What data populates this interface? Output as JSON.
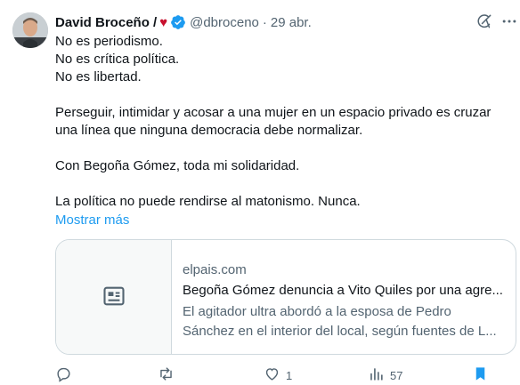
{
  "author": {
    "name": "David Broceño /",
    "emoji": "♥",
    "handle": "@dbroceno",
    "separator": "·",
    "date": "29 abr."
  },
  "tweet": {
    "lines": [
      "No es periodismo.",
      "No es crítica política.",
      "No es libertad.",
      "Perseguir, intimidar y acosar a una mujer en un espacio privado es cruzar",
      "una línea que ninguna democracia debe normalizar.",
      "Con Begoña Gómez, toda mi solidaridad.",
      "La política no puede rendirse al matonismo. Nunca."
    ],
    "show_more": "Mostrar más"
  },
  "card": {
    "domain": "elpais.com",
    "title": "Begoña Gómez denuncia a Vito Quiles por una agre...",
    "description_line1": "El agitador ultra abordó a la esposa de Pedro",
    "description_line2": "Sánchez en el interior del local, según fuentes de L..."
  },
  "actions": {
    "reply_count": "",
    "retweet_count": "",
    "like_count": "1",
    "views_count": "57"
  },
  "colors": {
    "accent": "#1d9bf0",
    "secondary_text": "#536471",
    "border": "#cfd9de",
    "heart": "#c8102e"
  },
  "icons": [
    "avatar",
    "verified-badge-icon",
    "grok-icon",
    "more-icon",
    "article-icon",
    "reply-icon",
    "retweet-icon",
    "like-icon",
    "views-icon",
    "bookmark-icon"
  ]
}
